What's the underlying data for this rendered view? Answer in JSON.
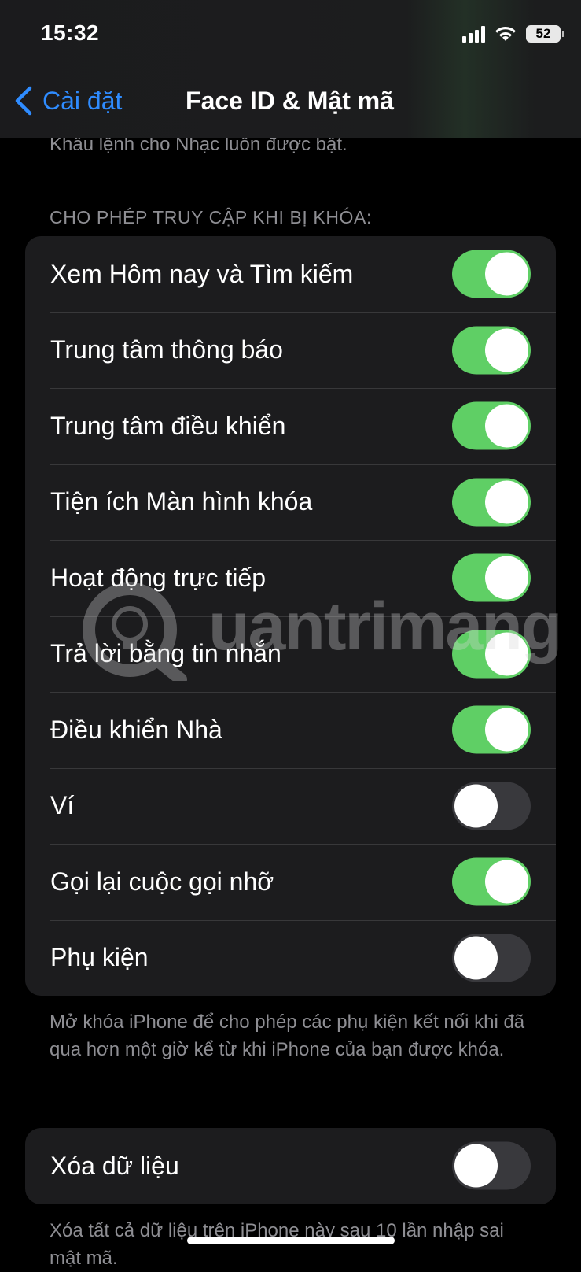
{
  "status_bar": {
    "time": "15:32",
    "battery": "52",
    "signal_icon": "cellular-signal-icon",
    "wifi_icon": "wifi-icon"
  },
  "nav": {
    "back_label": "Cài đặt",
    "title": "Face ID & Mật mã"
  },
  "top_partial_text": "Khẩu lệnh cho Nhạc luôn được bật.",
  "section": {
    "header": "CHO PHÉP TRUY CẬP KHI BỊ KHÓA:",
    "items": [
      {
        "label": "Xem Hôm nay và Tìm kiếm",
        "on": true
      },
      {
        "label": "Trung tâm thông báo",
        "on": true
      },
      {
        "label": "Trung tâm điều khiển",
        "on": true
      },
      {
        "label": "Tiện ích Màn hình khóa",
        "on": true
      },
      {
        "label": "Hoạt động trực tiếp",
        "on": true
      },
      {
        "label": "Trả lời bằng tin nhắn",
        "on": true
      },
      {
        "label": "Điều khiển Nhà",
        "on": true
      },
      {
        "label": "Ví",
        "on": false
      },
      {
        "label": "Gọi lại cuộc gọi nhỡ",
        "on": true
      },
      {
        "label": "Phụ kiện",
        "on": false
      }
    ],
    "footer": "Mở khóa iPhone để cho phép các phụ kiện kết nối khi đã qua hơn một giờ kể từ khi iPhone của bạn được khóa."
  },
  "erase": {
    "label": "Xóa dữ liệu",
    "on": false,
    "footer": "Xóa tất cả dữ liệu trên iPhone này sau 10 lần nhập sai mật mã."
  },
  "watermark": "uantrimang",
  "colors": {
    "accent": "#2f8cff",
    "toggle_on": "#5fcf65",
    "toggle_off": "#39393d",
    "group_bg": "#1c1c1e",
    "secondary_text": "#8e8e93"
  }
}
